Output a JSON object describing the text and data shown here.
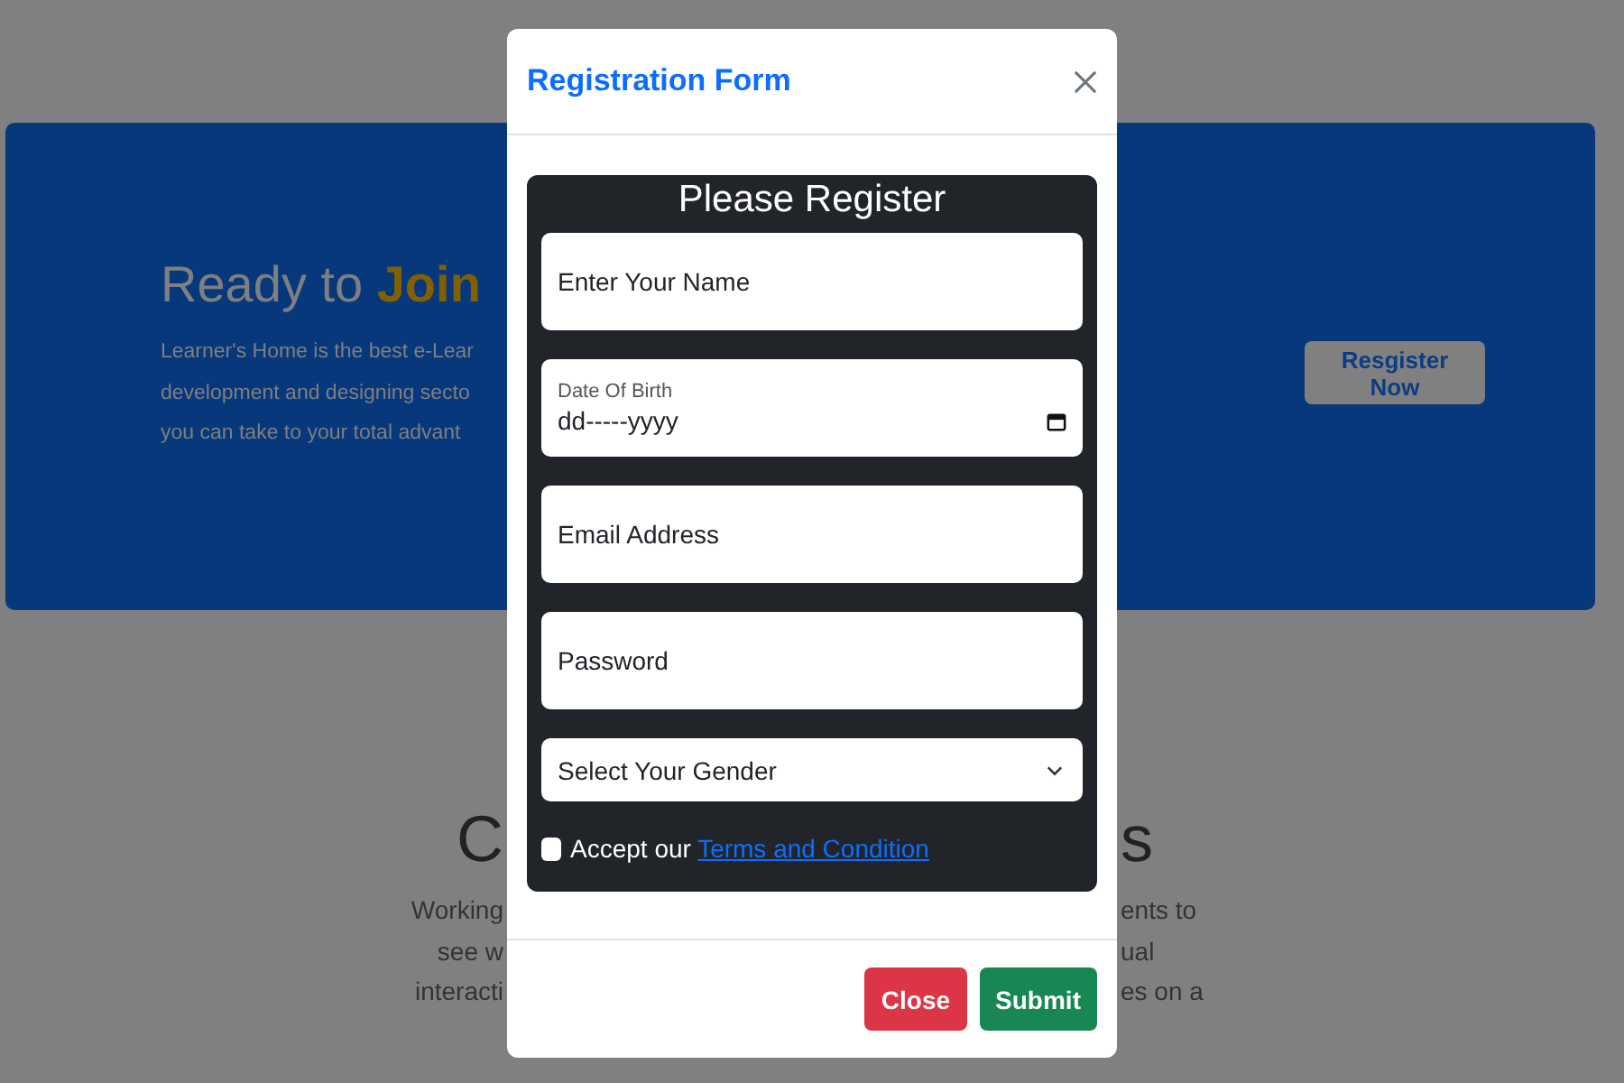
{
  "banner": {
    "heading": "Ready to ",
    "heading_highlight": "Join",
    "lines": [
      "Learner's Home is the best e-Lear",
      "development and designing secto",
      "you can take to your total advant"
    ],
    "button": "Resgister Now"
  },
  "section": {
    "heading_left": "C",
    "heading_right": "s",
    "left_lines": [
      "Working",
      "see w",
      "interacti"
    ],
    "right_lines": [
      "ents to",
      "ual",
      "es on a"
    ]
  },
  "modal": {
    "title": "Registration Form",
    "form": {
      "heading": "Please Register",
      "fields": [
        {
          "kind": "text",
          "placeholder": "Enter Your Name"
        },
        {
          "kind": "date",
          "label": "Date Of Birth",
          "value": "dd-----yyyy"
        },
        {
          "kind": "text",
          "placeholder": "Email Address"
        },
        {
          "kind": "text",
          "placeholder": "Password"
        },
        {
          "kind": "select",
          "value": "Select Your Gender"
        }
      ],
      "terms": {
        "checked": false,
        "text": "Accept our ",
        "link": "Terms and Condition"
      }
    },
    "buttons": [
      {
        "label": "Close",
        "kind": "danger"
      },
      {
        "label": "Submit",
        "kind": "success"
      }
    ]
  }
}
